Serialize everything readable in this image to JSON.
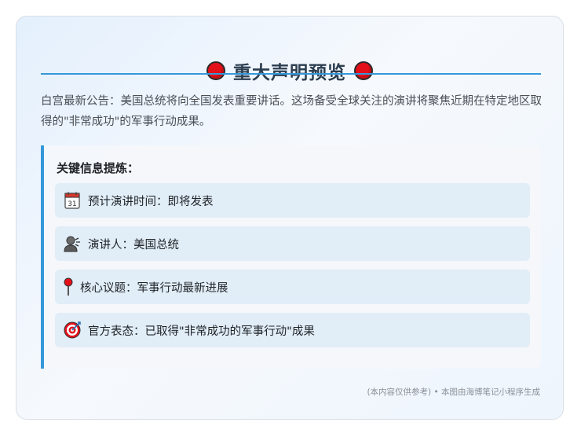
{
  "header": {
    "title": "重大声明预览",
    "title_icon": "red-circle-icon"
  },
  "intro": "白宫最新公告：美国总统将向全国发表重要讲话。这场备受全球关注的演讲将聚焦近期在特定地区取得的\"非常成功\"的军事行动成果。",
  "key_info": {
    "heading": "关键信息提炼：",
    "items": [
      {
        "icon": "calendar-icon",
        "text": "预计演讲时间：即将发表"
      },
      {
        "icon": "speaker-icon",
        "text": "演讲人：美国总统"
      },
      {
        "icon": "pushpin-icon",
        "text": "核心议题：军事行动最新进展"
      },
      {
        "icon": "target-icon",
        "text": "官方表态：已取得\"非常成功的军事行动\"成果"
      }
    ]
  },
  "footer": "(本内容仅供参考) • 本图由海博笔记小程序生成",
  "colors": {
    "accent": "#3498db",
    "title": "#2c3e50",
    "dot_red": "#e3101a",
    "item_bg": "#e1edf7"
  }
}
